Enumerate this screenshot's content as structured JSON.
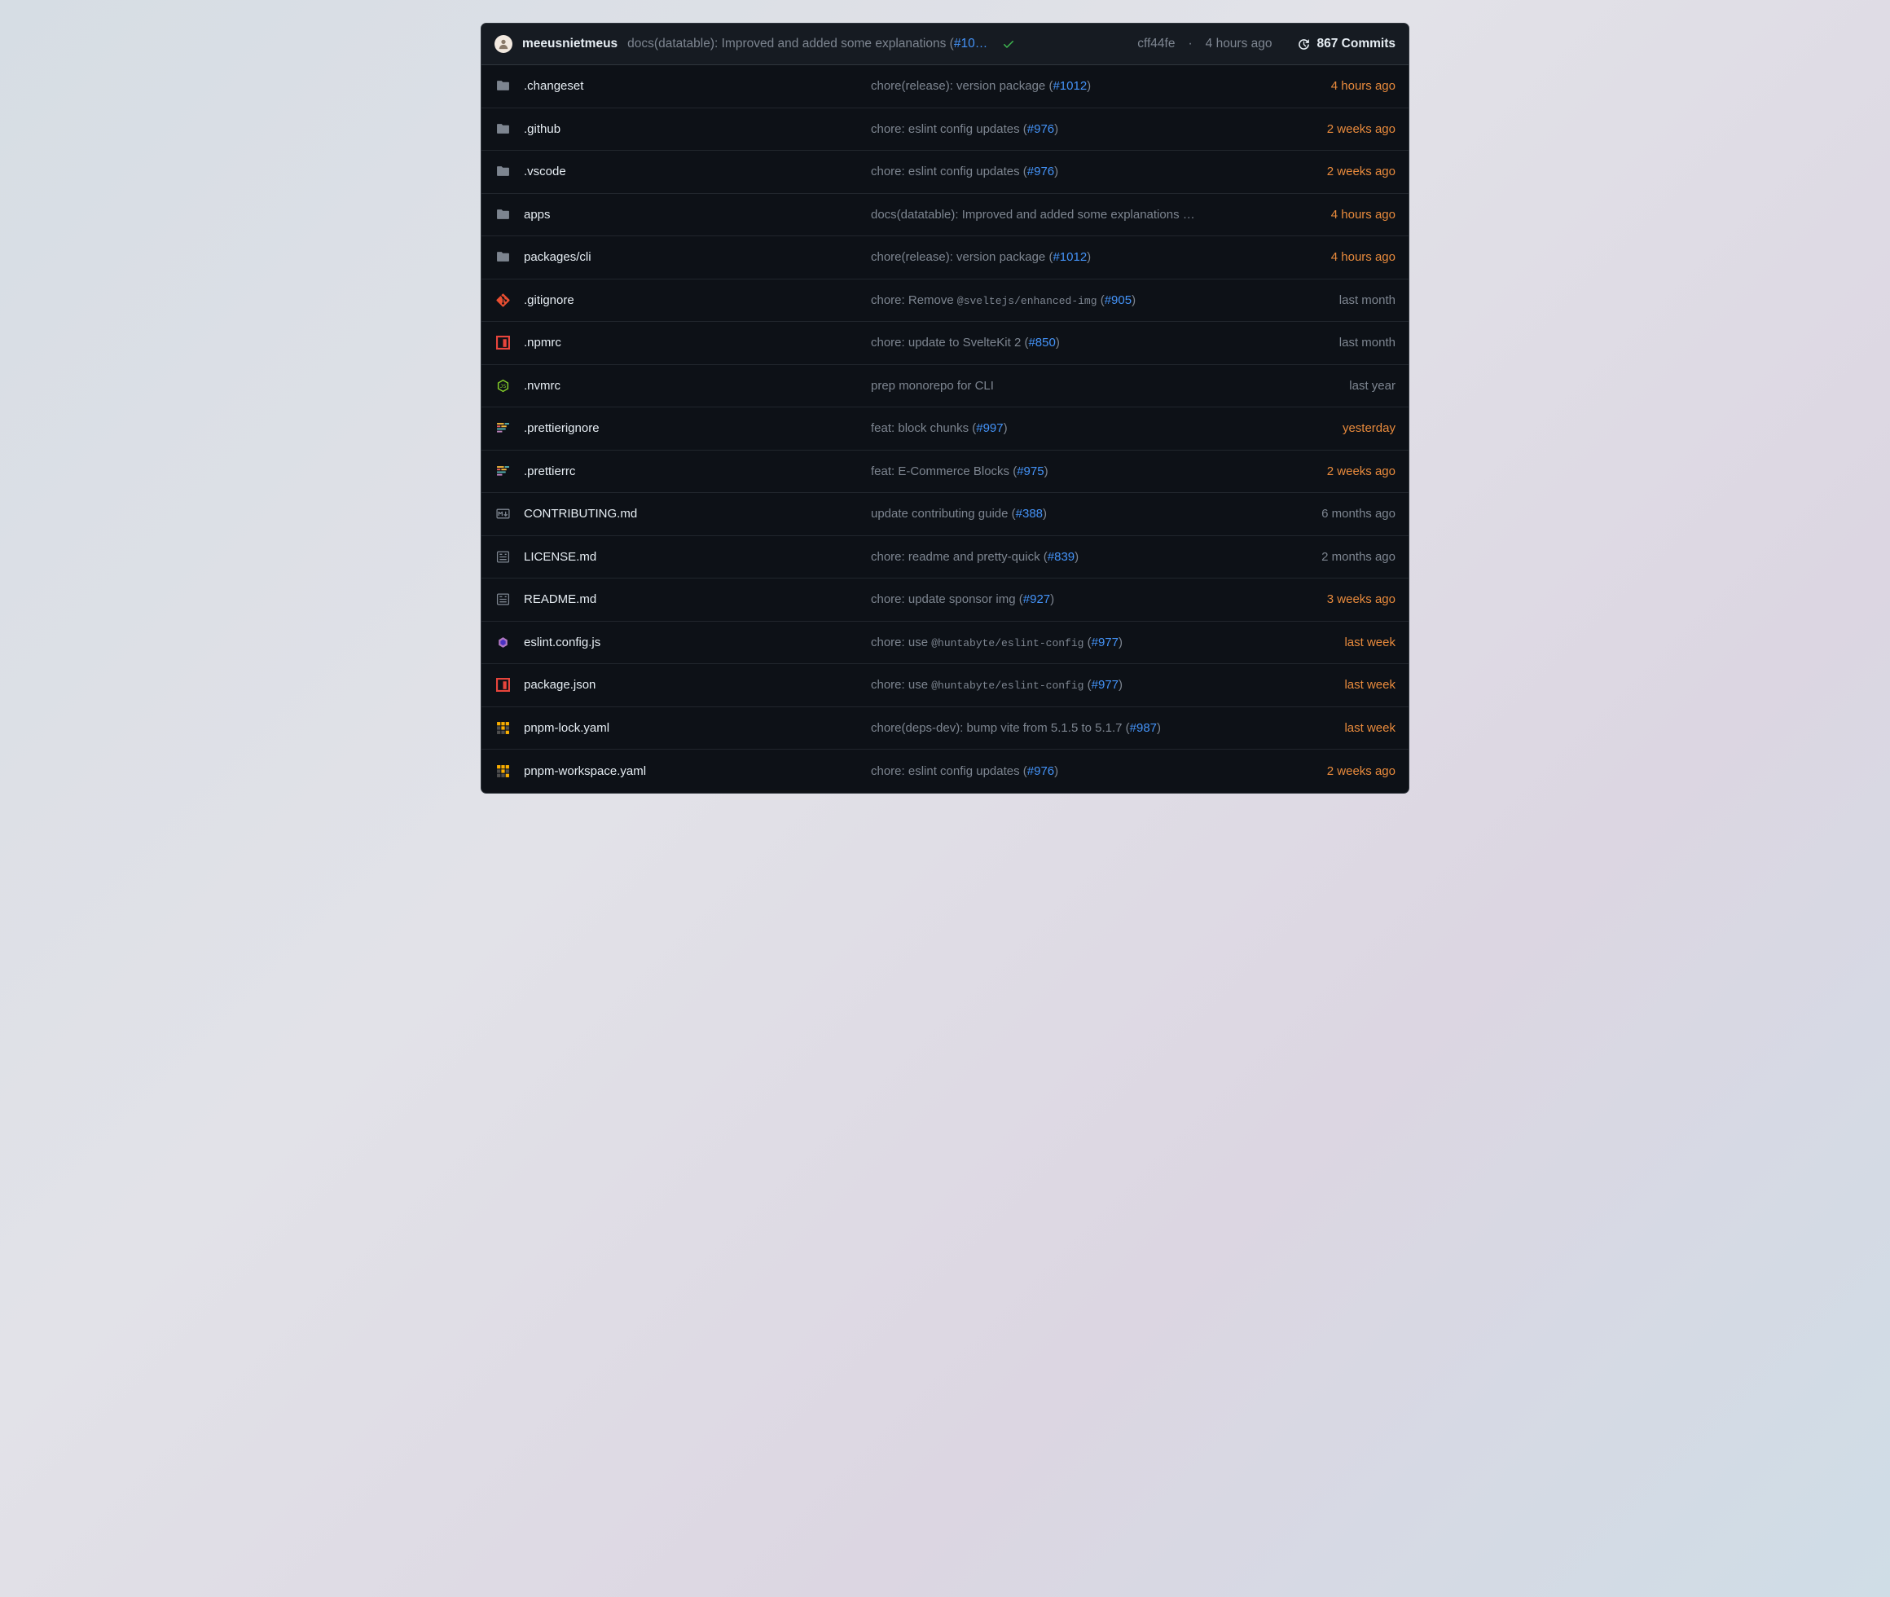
{
  "header": {
    "author": "meeusnietmeus",
    "commit_message_prefix": "docs(datatable): Improved and added some explanations (",
    "commit_message_pr": "#10…",
    "sha": "cff44fe",
    "time": "4 hours ago",
    "commits_count": "867 Commits"
  },
  "files": [
    {
      "icon": "folder",
      "name": ".changeset",
      "msg_before": "chore(release): version package (",
      "pr": "#1012",
      "msg_after": ")",
      "time": "4 hours ago",
      "recent": true
    },
    {
      "icon": "folder",
      "name": ".github",
      "msg_before": "chore: eslint config updates (",
      "pr": "#976",
      "msg_after": ")",
      "time": "2 weeks ago",
      "recent": true
    },
    {
      "icon": "folder",
      "name": ".vscode",
      "msg_before": "chore: eslint config updates (",
      "pr": "#976",
      "msg_after": ")",
      "time": "2 weeks ago",
      "recent": true
    },
    {
      "icon": "folder",
      "name": "apps",
      "msg_before": "docs(datatable): Improved and added some explanations …",
      "pr": "",
      "msg_after": "",
      "time": "4 hours ago",
      "recent": true
    },
    {
      "icon": "folder",
      "name": "packages/cli",
      "msg_before": "chore(release): version package (",
      "pr": "#1012",
      "msg_after": ")",
      "time": "4 hours ago",
      "recent": true
    },
    {
      "icon": "git",
      "name": ".gitignore",
      "msg_before": "chore: Remove ",
      "code": "@sveltejs/enhanced-img",
      "msg_mid": " (",
      "pr": "#905",
      "msg_after": ")",
      "time": "last month",
      "recent": false
    },
    {
      "icon": "npm",
      "name": ".npmrc",
      "msg_before": "chore: update to SvelteKit 2 (",
      "pr": "#850",
      "msg_after": ")",
      "time": "last month",
      "recent": false
    },
    {
      "icon": "node",
      "name": ".nvmrc",
      "msg_before": "prep monorepo for CLI",
      "pr": "",
      "msg_after": "",
      "time": "last year",
      "recent": false
    },
    {
      "icon": "prettier",
      "name": ".prettierignore",
      "msg_before": "feat: block chunks (",
      "pr": "#997",
      "msg_after": ")",
      "time": "yesterday",
      "recent": true
    },
    {
      "icon": "prettier",
      "name": ".prettierrc",
      "msg_before": "feat: E-Commerce Blocks (",
      "pr": "#975",
      "msg_after": ")",
      "time": "2 weeks ago",
      "recent": true
    },
    {
      "icon": "markdown",
      "name": "CONTRIBUTING.md",
      "msg_before": "update contributing guide (",
      "pr": "#388",
      "msg_after": ")",
      "time": "6 months ago",
      "recent": false
    },
    {
      "icon": "license",
      "name": "LICENSE.md",
      "msg_before": "chore: readme and pretty-quick (",
      "pr": "#839",
      "msg_after": ")",
      "time": "2 months ago",
      "recent": false
    },
    {
      "icon": "license",
      "name": "README.md",
      "msg_before": "chore: update sponsor img (",
      "pr": "#927",
      "msg_after": ")",
      "time": "3 weeks ago",
      "recent": true
    },
    {
      "icon": "eslint",
      "name": "eslint.config.js",
      "msg_before": "chore: use ",
      "code": "@huntabyte/eslint-config",
      "msg_mid": " (",
      "pr": "#977",
      "msg_after": ")",
      "time": "last week",
      "recent": true
    },
    {
      "icon": "npm",
      "name": "package.json",
      "msg_before": "chore: use ",
      "code": "@huntabyte/eslint-config",
      "msg_mid": " (",
      "pr": "#977",
      "msg_after": ")",
      "time": "last week",
      "recent": true
    },
    {
      "icon": "pnpm",
      "name": "pnpm-lock.yaml",
      "msg_before": "chore(deps-dev): bump vite from 5.1.5 to 5.1.7 (",
      "pr": "#987",
      "msg_after": ")",
      "time": "last week",
      "recent": true
    },
    {
      "icon": "pnpm",
      "name": "pnpm-workspace.yaml",
      "msg_before": "chore: eslint config updates (",
      "pr": "#976",
      "msg_after": ")",
      "time": "2 weeks ago",
      "recent": true
    }
  ]
}
